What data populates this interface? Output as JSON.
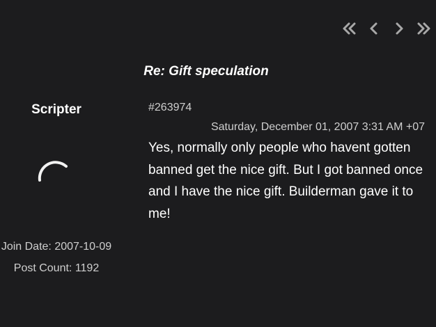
{
  "thread": {
    "title": "Re: Gift speculation"
  },
  "pager": {
    "first_icon": "double-chevron-left-icon",
    "prev_icon": "chevron-left-icon",
    "next_icon": "chevron-right-icon",
    "last_icon": "double-chevron-right-icon"
  },
  "author": {
    "name": "Scripter",
    "avatar_state": "loading-spinner",
    "join_date": "Join Date: 2007-10-09",
    "post_count": "Post Count: 1192"
  },
  "post": {
    "id": "#263974",
    "timestamp": "Saturday, December 01, 2007 3:31 AM +07",
    "body": "Yes, normally only people who havent gotten banned get the nice gift. But I got banned once and I have the nice gift. Builderman gave it to me!"
  },
  "colors": {
    "background": "#1c1c1e",
    "text_primary": "#ffffff",
    "text_secondary": "#cfcfcf",
    "icon": "#a8a8a8"
  }
}
